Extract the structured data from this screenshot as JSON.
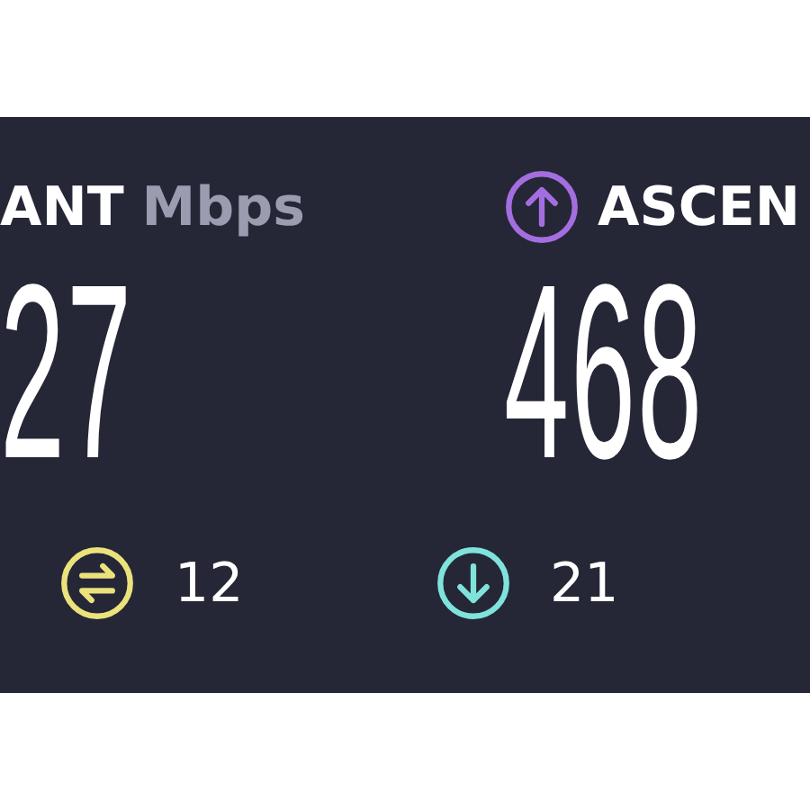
{
  "left": {
    "label": "ANT",
    "unit": "Mbps",
    "value": "27"
  },
  "right": {
    "kind": "upload",
    "label": "ASCEN",
    "value": "468"
  },
  "stats": [
    {
      "kind": "ping",
      "value": "12"
    },
    {
      "kind": "download",
      "value": "21"
    }
  ]
}
